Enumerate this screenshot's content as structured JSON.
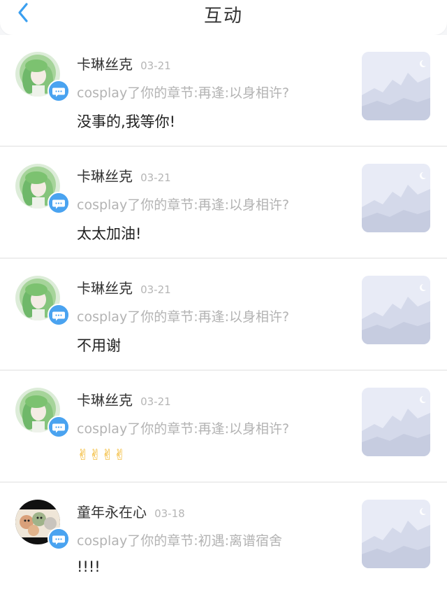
{
  "header": {
    "title": "互动",
    "back_icon": "chevron-left-icon",
    "accent_color": "#3a9ff0"
  },
  "notifications": [
    {
      "user": "卡琳丝克",
      "date": "03-21",
      "context": "cosplay了你的章节:再逢:以身相许?",
      "reply": "没事的,我等你!",
      "avatar": "green-hair-anime-avatar"
    },
    {
      "user": "卡琳丝克",
      "date": "03-21",
      "context": "cosplay了你的章节:再逢:以身相许?",
      "reply": "太太加油!",
      "avatar": "green-hair-anime-avatar"
    },
    {
      "user": "卡琳丝克",
      "date": "03-21",
      "context": "cosplay了你的章节:再逢:以身相许?",
      "reply": "不用谢",
      "avatar": "green-hair-anime-avatar"
    },
    {
      "user": "卡琳丝克",
      "date": "03-21",
      "context": "cosplay了你的章节:再逢:以身相许?",
      "reply": "✌✌✌✌",
      "avatar": "green-hair-anime-avatar"
    },
    {
      "user": "童年永在心",
      "date": "03-18",
      "context": "cosplay了你的章节:初遇:离谱宿舍",
      "reply": "!!!!",
      "avatar": "cartoon-group-avatar"
    }
  ],
  "badge_icon": "comment-bubble-icon",
  "badge_color": "#4aa3f0",
  "thumbnail_icon": "image-placeholder-icon"
}
